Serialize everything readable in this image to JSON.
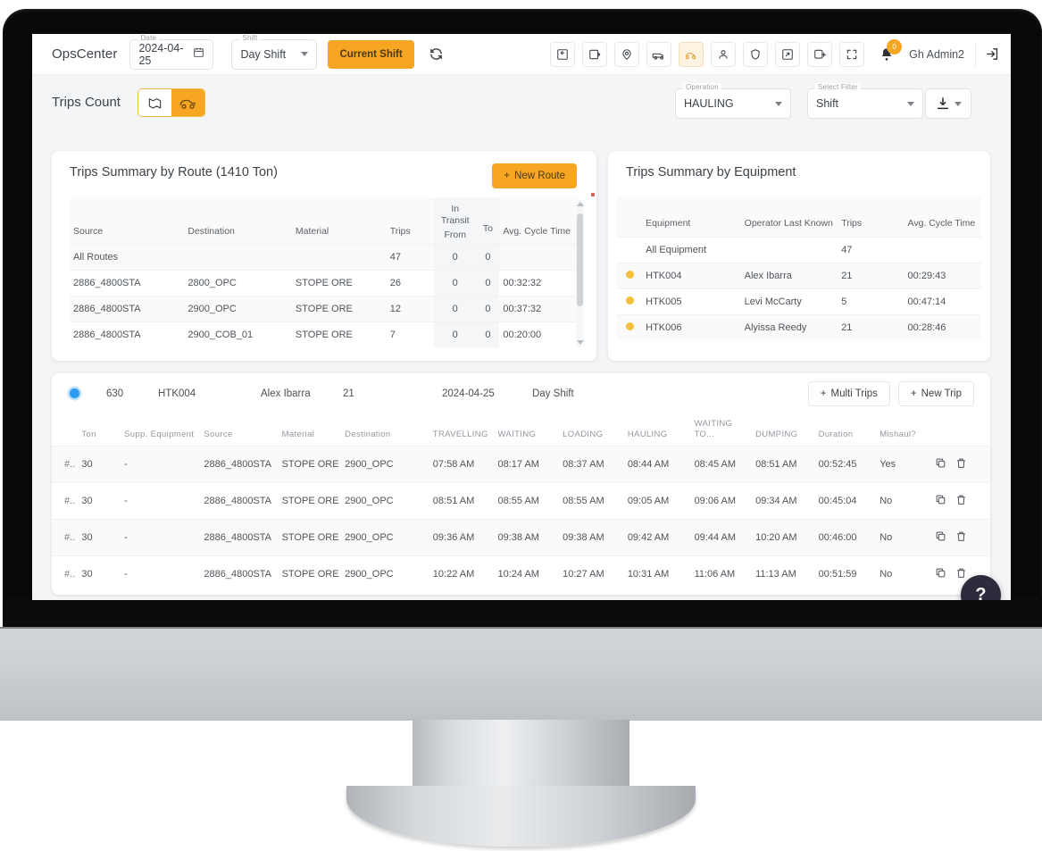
{
  "header": {
    "brand": "OpsCenter",
    "date_label": "Date",
    "date_value": "2024-04-25",
    "shift_label": "Shift",
    "shift_value": "Day Shift",
    "current_shift_button": "Current Shift",
    "user_name": "Gh Admin2",
    "notification_count": "0",
    "tools": [
      {
        "name": "import-data-icon"
      },
      {
        "name": "export-data-icon"
      },
      {
        "name": "location-pin-icon"
      },
      {
        "name": "truck-icon"
      },
      {
        "name": "loader-icon"
      },
      {
        "name": "operator-icon"
      },
      {
        "name": "shield-icon"
      },
      {
        "name": "open-external-icon"
      },
      {
        "name": "add-image-icon"
      },
      {
        "name": "fullscreen-icon"
      }
    ]
  },
  "subheader": {
    "title": "Trips Count",
    "view_toggle": [
      {
        "name": "map-view-icon",
        "active": false
      },
      {
        "name": "equipment-view-icon",
        "active": true
      }
    ],
    "operation_label": "Operation",
    "operation_value": "HAULING",
    "filter_label": "Select Filter",
    "filter_value": "Shift"
  },
  "route_card": {
    "title": "Trips Summary by Route (1410 Ton)",
    "new_route_button": "New Route",
    "columns": [
      "Source",
      "Destination",
      "Material",
      "Trips",
      "In Transit",
      "From",
      "To",
      "Avg. Cycle Time"
    ],
    "rows": [
      {
        "source": "All Routes",
        "destination": "",
        "material": "",
        "trips": "47",
        "from": "0",
        "to": "0",
        "cycle": ""
      },
      {
        "source": "2886_4800STA",
        "destination": "2800_OPC",
        "material": "STOPE ORE",
        "trips": "26",
        "from": "0",
        "to": "0",
        "cycle": "00:32:32"
      },
      {
        "source": "2886_4800STA",
        "destination": "2900_OPC",
        "material": "STOPE ORE",
        "trips": "12",
        "from": "0",
        "to": "0",
        "cycle": "00:37:32"
      },
      {
        "source": "2886_4800STA",
        "destination": "2900_COB_01",
        "material": "STOPE ORE",
        "trips": "7",
        "from": "0",
        "to": "0",
        "cycle": "00:20:00"
      }
    ]
  },
  "equipment_card": {
    "title": "Trips Summary by Equipment",
    "columns": [
      "Equipment",
      "Operator Last Known",
      "Trips",
      "Avg. Cycle Time"
    ],
    "rows": [
      {
        "equipment": "All Equipment",
        "operator": "",
        "trips": "47",
        "cycle": "",
        "has_status": false
      },
      {
        "equipment": "HTK004",
        "operator": "Alex Ibarra",
        "trips": "21",
        "cycle": "00:29:43",
        "has_status": true
      },
      {
        "equipment": "HTK005",
        "operator": "Levi McCarty",
        "trips": "5",
        "cycle": "00:47:14",
        "has_status": true
      },
      {
        "equipment": "HTK006",
        "operator": "Alyissa Reedy",
        "trips": "21",
        "cycle": "00:28:46",
        "has_status": true
      }
    ]
  },
  "detail_card": {
    "summary": {
      "id": "630",
      "equipment": "HTK004",
      "operator": "Alex Ibarra",
      "trips": "21",
      "date": "2024-04-25",
      "shift": "Day Shift"
    },
    "multi_trips_button": "Multi Trips",
    "new_trip_button": "New Trip",
    "columns": [
      "",
      "Ton",
      "Supp. Equipment",
      "Source",
      "Material",
      "Destination",
      "TRAVELLING",
      "WAITING",
      "LOADING",
      "HAULING",
      "WAITING TO...",
      "DUMPING",
      "Duration",
      "Mishaul?"
    ],
    "rows": [
      {
        "num": "#..",
        "ton": "30",
        "supp": "-",
        "source": "2886_4800STA",
        "material": "STOPE ORE",
        "destination": "2900_OPC",
        "travelling": "07:58 AM",
        "waiting": "08:17 AM",
        "loading": "08:37 AM",
        "hauling": "08:44 AM",
        "waiting_to": "08:45 AM",
        "dumping": "08:51 AM",
        "duration": "00:52:45",
        "mishaul": "Yes"
      },
      {
        "num": "#..",
        "ton": "30",
        "supp": "-",
        "source": "2886_4800STA",
        "material": "STOPE ORE",
        "destination": "2900_OPC",
        "travelling": "08:51 AM",
        "waiting": "08:55 AM",
        "loading": "08:55 AM",
        "hauling": "09:05 AM",
        "waiting_to": "09:06 AM",
        "dumping": "09:34 AM",
        "duration": "00:45:04",
        "mishaul": "No"
      },
      {
        "num": "#..",
        "ton": "30",
        "supp": "-",
        "source": "2886_4800STA",
        "material": "STOPE ORE",
        "destination": "2900_OPC",
        "travelling": "09:36 AM",
        "waiting": "09:38 AM",
        "loading": "09:38 AM",
        "hauling": "09:42 AM",
        "waiting_to": "09:44 AM",
        "dumping": "10:20 AM",
        "duration": "00:46:00",
        "mishaul": "No"
      },
      {
        "num": "#..",
        "ton": "30",
        "supp": "-",
        "source": "2886_4800STA",
        "material": "STOPE ORE",
        "destination": "2900_OPC",
        "travelling": "10:22 AM",
        "waiting": "10:24 AM",
        "loading": "10:27 AM",
        "hauling": "10:31 AM",
        "waiting_to": "11:06 AM",
        "dumping": "11:13 AM",
        "duration": "00:51:59",
        "mishaul": "No"
      }
    ]
  },
  "help_button": "?",
  "colors": {
    "accent": "#f6a623",
    "status_dot": "#f5c13b",
    "selected_dot": "#2b9cf0",
    "mishaul_yes": "#e8405a",
    "help_fab": "#2e2b3d"
  }
}
